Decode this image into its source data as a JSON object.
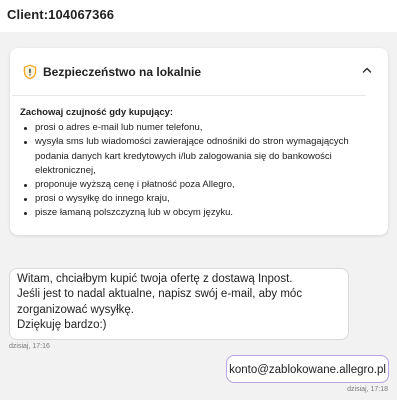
{
  "header": {
    "client_label": "Client:104067366"
  },
  "security_card": {
    "title": "Bezpieczeństwo na lokalnie",
    "expanded": true,
    "intro": "Zachowaj czujność gdy kupujący:",
    "items": [
      "prosi o adres e-mail lub numer telefonu,",
      "wysyła sms lub wiadomości zawierające odnośniki do stron wymagających podania danych kart kredytowych i/lub zalogowania się do bankowości elektronicznej,",
      "proponuje wyższą cenę i płatność poza Allegro,",
      "prosi o wysyłkę do innego kraju,",
      "pisze łamaną polszczyzną lub w obcym języku."
    ],
    "icon": "shield-alert-icon",
    "accent_color": "#f5a623"
  },
  "messages": [
    {
      "direction": "incoming",
      "text": "Witam, chciałbym kupić twoja ofertę z dostawą Inpost.\nJeśli jest to nadal aktualne, napisz swój e-mail, aby móc zorganizować wysyłkę.\nDziękuję bardzo:)",
      "time": "dzisiaj, 17:16"
    },
    {
      "direction": "outgoing",
      "text": "konto@zablokowane.allegro.pl",
      "time": "dzisiaj, 17:18",
      "border_color": "#b8a3de"
    }
  ]
}
